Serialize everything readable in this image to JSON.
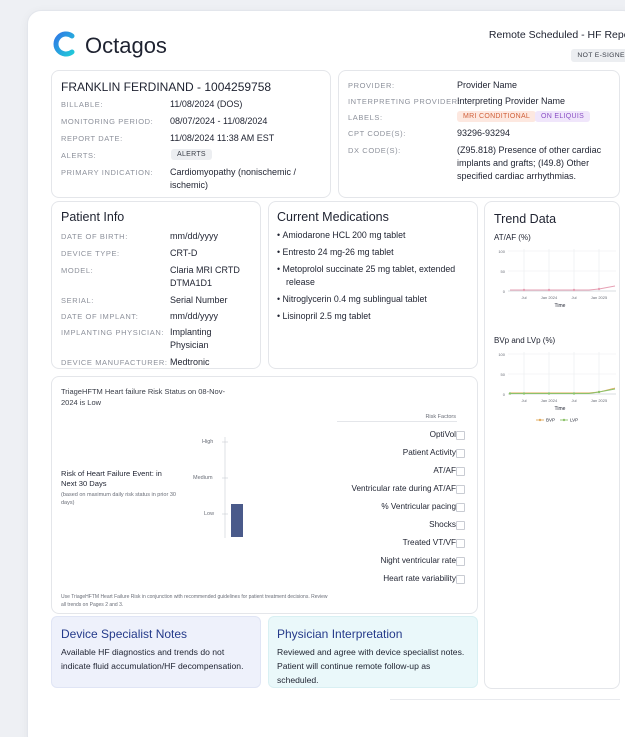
{
  "brand": {
    "name": "Octagos",
    "logo": "octagos-logo"
  },
  "report": {
    "title": "Remote Scheduled - HF Report",
    "sign_status": "NOT E-SIGNED"
  },
  "patient_header": {
    "name": "FRANKLIN FERDINAND - 1004259758",
    "fields": [
      {
        "label": "BILLABLE:",
        "value": "11/08/2024 (DOS)"
      },
      {
        "label": "MONITORING PERIOD:",
        "value": "08/07/2024 - 11/08/2024"
      },
      {
        "label": "REPORT DATE:",
        "value": "11/08/2024 11:38 AM EST"
      },
      {
        "label": "ALERTS:",
        "value": "ALERTS"
      },
      {
        "label": "PRIMARY INDICATION:",
        "value": "Cardiomyopathy (nonischemic / ischemic)"
      }
    ]
  },
  "provider": {
    "fields": [
      {
        "label": "PROVIDER:",
        "value": "Provider Name"
      },
      {
        "label": "INTERPRETING PROVIDER:",
        "value": "Interpreting Provider Name"
      },
      {
        "label": "LABELS:",
        "badges": [
          "MRI CONDITIONAL",
          "ON ELIQUIS"
        ]
      },
      {
        "label": "CPT CODE(S):",
        "value": "93296-93294"
      },
      {
        "label": "DX CODE(S):",
        "value": "(Z95.818) Presence of other cardiac implants and grafts; (I49.8) Other specified cardiac arrhythmias."
      }
    ]
  },
  "patient_info": {
    "title": "Patient Info",
    "fields": [
      {
        "label": "DATE OF BIRTH:",
        "value": "mm/dd/yyyy"
      },
      {
        "label": "DEVICE TYPE:",
        "value": "CRT-D"
      },
      {
        "label": "MODEL:",
        "value": "Claria MRI CRTD DTMA1D1"
      },
      {
        "label": "SERIAL:",
        "value": "Serial Number"
      },
      {
        "label": "DATE OF IMPLANT:",
        "value": "mm/dd/yyyy"
      },
      {
        "label": "IMPLANTING PHYSICIAN:",
        "value": "Implanting Physician"
      },
      {
        "label": "DEVICE MANUFACTURER:",
        "value": "Medtronic"
      }
    ]
  },
  "medications": {
    "title": "Current Medications",
    "items": [
      "Amiodarone HCL 200 mg tablet",
      "Entresto 24 mg-26 mg tablet",
      "Metoprolol succinate 25 mg tablet, extended release",
      "Nitroglycerin 0.4 mg sublingual tablet",
      "Lisinopril 2.5 mg tablet"
    ]
  },
  "trend": {
    "title": "Trend Data",
    "charts": [
      {
        "title": "AT/AF (%)",
        "y_ticks": [
          "100",
          "50",
          "0"
        ],
        "x_ticks": [
          "Jul",
          "Jan 2024",
          "Jul",
          "Jan 2025"
        ],
        "x_label": "Time",
        "series_color": "#e6a0b4"
      },
      {
        "title": "BVp and LVp (%)",
        "y_ticks": [
          "100",
          "50",
          "0"
        ],
        "x_ticks": [
          "Jul",
          "Jan 2024",
          "Jul",
          "Jan 2025"
        ],
        "x_label": "Time",
        "legend": [
          "BVP",
          "LVP"
        ],
        "colors": [
          "#e0a95a",
          "#8cc26a"
        ]
      }
    ]
  },
  "triage": {
    "status": "TriageHFTM Heart failure Risk Status on 08-Nov-2024 is Low",
    "risk_label": "Risk of Heart Failure Event: in Next 30 Days",
    "risk_note": "(based on maximum daily risk status in prior 30 days)",
    "levels": [
      "High",
      "Medium",
      "Low"
    ],
    "current_level": "Low",
    "risk_factors_title": "Risk Factors",
    "risk_factors": [
      "OptiVol",
      "Patient Activity",
      "AT/AF",
      "Ventricular rate during AT/AF",
      "% Ventricular pacing",
      "Shocks",
      "Treated VT/VF",
      "Night ventricular rate",
      "Heart rate variability"
    ],
    "footnote": "Use TriageHFTM Heart Failure Risk in conjunction with recommended guidelines for patient treatment decisions. Review all trends on Pages 2 and 3.",
    "bar_color": "#4a5a8a"
  },
  "specialist_notes": {
    "title": "Device Specialist Notes",
    "text": "Available HF diagnostics and trends do not indicate fluid accumulation/HF decompensation."
  },
  "physician": {
    "title": "Physician Interpretation",
    "text": "Reviewed and agree with device specialist notes. Patient will continue remote follow-up as scheduled."
  },
  "colors": {
    "notes_bg": "#eef1fb",
    "physician_bg": "#eaf8fa",
    "mri_badge": "#fde8e0",
    "eliquis_badge": "#f0e6fb"
  }
}
